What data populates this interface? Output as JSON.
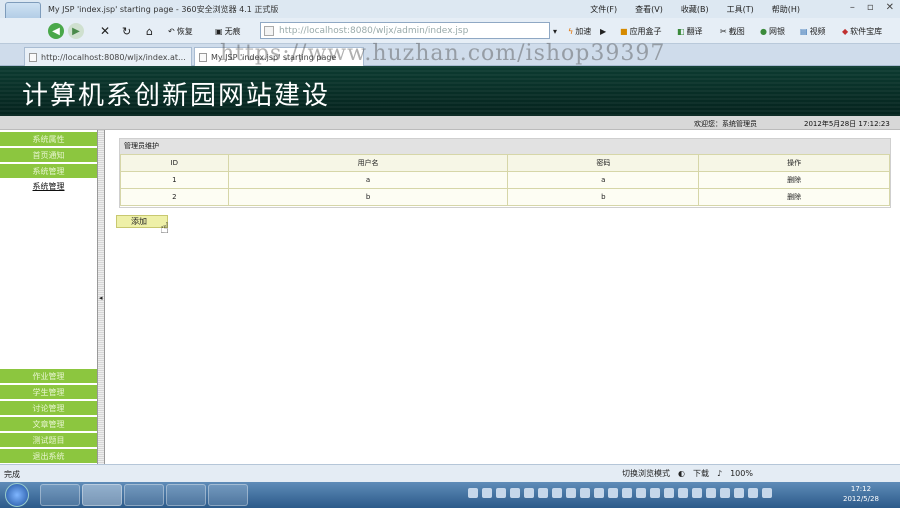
{
  "window": {
    "title": "My JSP 'index.jsp' starting page - 360安全浏览器 4.1 正式版",
    "menu": [
      "文件(F)",
      "查看(V)",
      "收藏(B)",
      "工具(T)",
      "帮助(H)"
    ]
  },
  "toolbar": {
    "restore_label": "恢复",
    "no_trace_label": "无痕",
    "address": "http://localhost:8080/wljx/admin/index.jsp",
    "accelerate_label": "加速",
    "app_box_label": "应用盒子",
    "translate_label": "翻译",
    "screenshot_label": "截图",
    "netbank_label": "网银",
    "video_label": "视频",
    "software_label": "软件宝库"
  },
  "tabs": [
    {
      "label": "http://localhost:8080/wljx/index.at..."
    },
    {
      "label": "My JSP 'index.jsp' starting page"
    }
  ],
  "watermark": "https://www.huzhan.com/ishop39397",
  "site": {
    "title": "计算机系创新园网站建设"
  },
  "userbar": {
    "welcome": "欢迎您：系统管理员",
    "datetime": "2012年5月28日  17:12:23"
  },
  "sidebar": {
    "top_items": [
      "系统属性",
      "首页通知",
      "系统管理"
    ],
    "active_item": "系统管理",
    "bottom_items": [
      "作业管理",
      "学生管理",
      "讨论管理",
      "文章管理",
      "测试题目",
      "退出系统"
    ]
  },
  "panel": {
    "title": "管理员维护",
    "columns": [
      "ID",
      "用户名",
      "密码",
      "操作"
    ],
    "rows": [
      {
        "id": "1",
        "username": "a",
        "password": "a",
        "action": "删除"
      },
      {
        "id": "2",
        "username": "b",
        "password": "b",
        "action": "删除"
      }
    ],
    "add_label": "添加"
  },
  "statusbar": {
    "status": "完成",
    "switch_mode": "切换浏览模式",
    "download": "下载",
    "zoom": "100%"
  },
  "clock": {
    "time": "17:12",
    "date": "2012/5/28"
  }
}
